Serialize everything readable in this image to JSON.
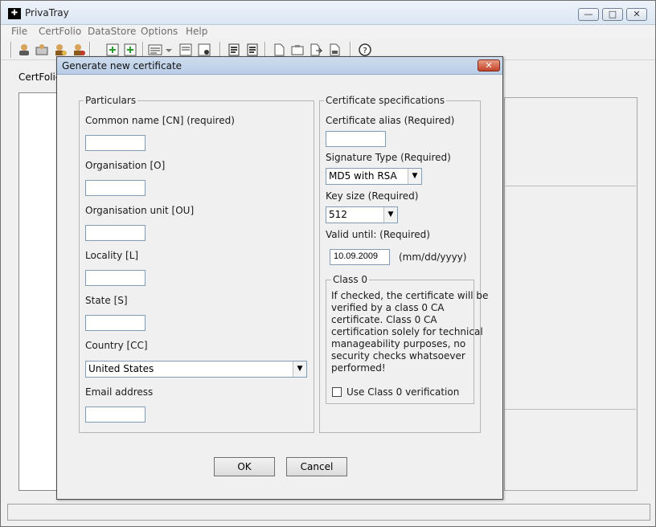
{
  "window": {
    "title": "PrivaTray",
    "minimize_glyph": "—",
    "maximize_glyph": "□",
    "close_glyph": "✕",
    "app_icon_glyph": "✚"
  },
  "menu": [
    "File",
    "CertFolio",
    "DataStore",
    "Options",
    "Help"
  ],
  "toolbar": {
    "icons": [
      "users-icon",
      "folder-user-icon",
      "user-key-icon",
      "user-cert-icon",
      "add-item-icon",
      "edit-list-icon",
      "dropdown-arrow-icon",
      "doc-cert-icon",
      "doc-lock-icon",
      "sign-icon",
      "verify-icon",
      "doc-a-icon",
      "doc-b-icon",
      "doc-arrow-icon",
      "doc-c-icon",
      "help-icon"
    ]
  },
  "tab": {
    "label": "CertFolio"
  },
  "dialog": {
    "title": "Generate new certificate",
    "close_glyph": "✕",
    "particulars": {
      "legend": "Particulars",
      "common_name_label": "Common name [CN] (required)",
      "organisation_label": "Organisation [O]",
      "org_unit_label": "Organisation unit [OU]",
      "locality_label": "Locality [L]",
      "state_label": "State [S]",
      "country_label": "Country [CC]",
      "country_value": "United States",
      "email_label": "Email address"
    },
    "specs": {
      "legend": "Certificate specifications",
      "alias_label": "Certificate alias (Required)",
      "signature_label": "Signature Type (Required)",
      "signature_value": "MD5 with RSA",
      "key_size_label": "Key size (Required)",
      "key_size_value": "512",
      "valid_until_label": "Valid until: (Required)",
      "valid_until_value": "10.09.2009",
      "date_format_hint": "(mm/dd/yyyy)"
    },
    "class0": {
      "legend": "Class 0",
      "lines": [
        "If checked, the certificate will be",
        "verified by a class 0 CA",
        "certificate. Class 0 CA",
        "certification solely for technical",
        "manageability purposes, no",
        "security checks whatsoever",
        "performed!"
      ],
      "checkbox_label": "Use Class 0 verification"
    },
    "ok_label": "OK",
    "cancel_label": "Cancel"
  },
  "colors": {
    "titlebar": "#dbe6f3",
    "dialog_titlebar": "#b9cde6",
    "close_button": "#c2432a",
    "field_border": "#7f9db9"
  }
}
